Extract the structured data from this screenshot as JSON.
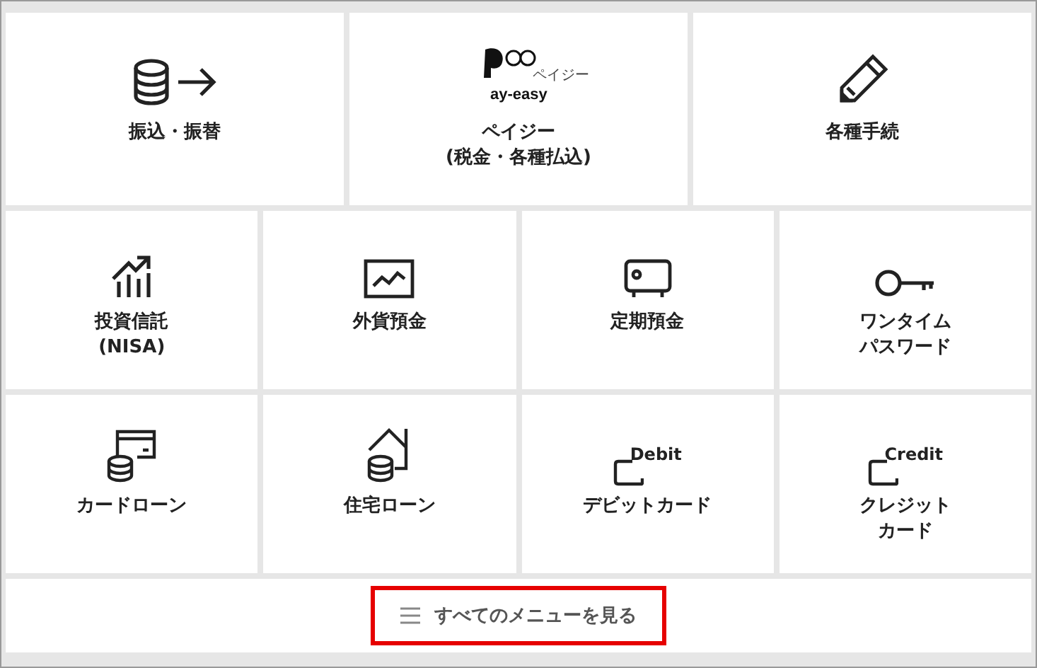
{
  "top_row": [
    {
      "lines": [
        "振込・振替"
      ]
    },
    {
      "lines": [
        "ペイジー",
        "(税金・各種払込)"
      ],
      "logo_text": "ay-easy",
      "logo_caption": "ペイジー"
    },
    {
      "lines": [
        "各種手続"
      ]
    }
  ],
  "middle_row": [
    {
      "lines": [
        "投資信託",
        "(NISA)"
      ]
    },
    {
      "lines": [
        "外貨預金"
      ]
    },
    {
      "lines": [
        "定期預金"
      ]
    },
    {
      "lines": [
        "ワンタイム",
        "パスワード"
      ]
    }
  ],
  "bottom_row": [
    {
      "lines": [
        "カードローン"
      ]
    },
    {
      "lines": [
        "住宅ローン"
      ]
    },
    {
      "lines": [
        "デビットカード"
      ],
      "icon_text": "Debit"
    },
    {
      "lines": [
        "クレジット",
        "カード"
      ],
      "icon_text": "Credit"
    }
  ],
  "all_menu": {
    "label": "すべてのメニューを見る",
    "highlighted": true
  }
}
